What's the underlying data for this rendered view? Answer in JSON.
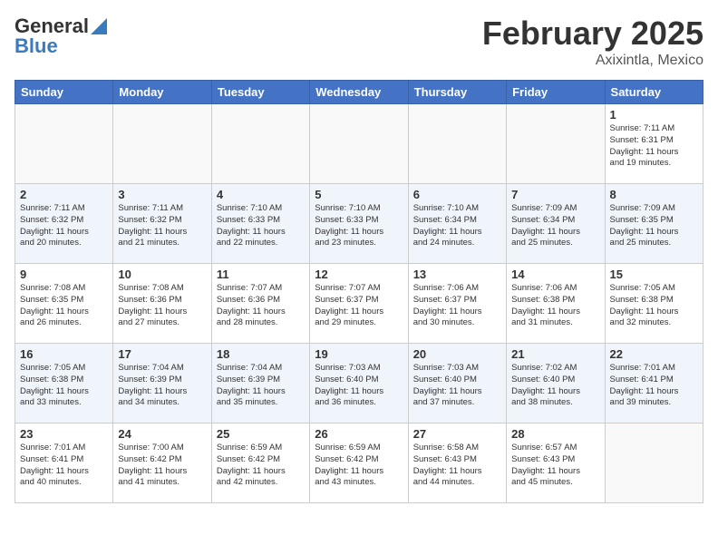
{
  "header": {
    "logo_general": "General",
    "logo_blue": "Blue",
    "month_title": "February 2025",
    "location": "Axixintla, Mexico"
  },
  "days_of_week": [
    "Sunday",
    "Monday",
    "Tuesday",
    "Wednesday",
    "Thursday",
    "Friday",
    "Saturday"
  ],
  "weeks": [
    {
      "days": [
        {
          "num": "",
          "info": ""
        },
        {
          "num": "",
          "info": ""
        },
        {
          "num": "",
          "info": ""
        },
        {
          "num": "",
          "info": ""
        },
        {
          "num": "",
          "info": ""
        },
        {
          "num": "",
          "info": ""
        },
        {
          "num": "1",
          "info": "Sunrise: 7:11 AM\nSunset: 6:31 PM\nDaylight: 11 hours\nand 19 minutes."
        }
      ]
    },
    {
      "days": [
        {
          "num": "2",
          "info": "Sunrise: 7:11 AM\nSunset: 6:32 PM\nDaylight: 11 hours\nand 20 minutes."
        },
        {
          "num": "3",
          "info": "Sunrise: 7:11 AM\nSunset: 6:32 PM\nDaylight: 11 hours\nand 21 minutes."
        },
        {
          "num": "4",
          "info": "Sunrise: 7:10 AM\nSunset: 6:33 PM\nDaylight: 11 hours\nand 22 minutes."
        },
        {
          "num": "5",
          "info": "Sunrise: 7:10 AM\nSunset: 6:33 PM\nDaylight: 11 hours\nand 23 minutes."
        },
        {
          "num": "6",
          "info": "Sunrise: 7:10 AM\nSunset: 6:34 PM\nDaylight: 11 hours\nand 24 minutes."
        },
        {
          "num": "7",
          "info": "Sunrise: 7:09 AM\nSunset: 6:34 PM\nDaylight: 11 hours\nand 25 minutes."
        },
        {
          "num": "8",
          "info": "Sunrise: 7:09 AM\nSunset: 6:35 PM\nDaylight: 11 hours\nand 25 minutes."
        }
      ]
    },
    {
      "days": [
        {
          "num": "9",
          "info": "Sunrise: 7:08 AM\nSunset: 6:35 PM\nDaylight: 11 hours\nand 26 minutes."
        },
        {
          "num": "10",
          "info": "Sunrise: 7:08 AM\nSunset: 6:36 PM\nDaylight: 11 hours\nand 27 minutes."
        },
        {
          "num": "11",
          "info": "Sunrise: 7:07 AM\nSunset: 6:36 PM\nDaylight: 11 hours\nand 28 minutes."
        },
        {
          "num": "12",
          "info": "Sunrise: 7:07 AM\nSunset: 6:37 PM\nDaylight: 11 hours\nand 29 minutes."
        },
        {
          "num": "13",
          "info": "Sunrise: 7:06 AM\nSunset: 6:37 PM\nDaylight: 11 hours\nand 30 minutes."
        },
        {
          "num": "14",
          "info": "Sunrise: 7:06 AM\nSunset: 6:38 PM\nDaylight: 11 hours\nand 31 minutes."
        },
        {
          "num": "15",
          "info": "Sunrise: 7:05 AM\nSunset: 6:38 PM\nDaylight: 11 hours\nand 32 minutes."
        }
      ]
    },
    {
      "days": [
        {
          "num": "16",
          "info": "Sunrise: 7:05 AM\nSunset: 6:38 PM\nDaylight: 11 hours\nand 33 minutes."
        },
        {
          "num": "17",
          "info": "Sunrise: 7:04 AM\nSunset: 6:39 PM\nDaylight: 11 hours\nand 34 minutes."
        },
        {
          "num": "18",
          "info": "Sunrise: 7:04 AM\nSunset: 6:39 PM\nDaylight: 11 hours\nand 35 minutes."
        },
        {
          "num": "19",
          "info": "Sunrise: 7:03 AM\nSunset: 6:40 PM\nDaylight: 11 hours\nand 36 minutes."
        },
        {
          "num": "20",
          "info": "Sunrise: 7:03 AM\nSunset: 6:40 PM\nDaylight: 11 hours\nand 37 minutes."
        },
        {
          "num": "21",
          "info": "Sunrise: 7:02 AM\nSunset: 6:40 PM\nDaylight: 11 hours\nand 38 minutes."
        },
        {
          "num": "22",
          "info": "Sunrise: 7:01 AM\nSunset: 6:41 PM\nDaylight: 11 hours\nand 39 minutes."
        }
      ]
    },
    {
      "days": [
        {
          "num": "23",
          "info": "Sunrise: 7:01 AM\nSunset: 6:41 PM\nDaylight: 11 hours\nand 40 minutes."
        },
        {
          "num": "24",
          "info": "Sunrise: 7:00 AM\nSunset: 6:42 PM\nDaylight: 11 hours\nand 41 minutes."
        },
        {
          "num": "25",
          "info": "Sunrise: 6:59 AM\nSunset: 6:42 PM\nDaylight: 11 hours\nand 42 minutes."
        },
        {
          "num": "26",
          "info": "Sunrise: 6:59 AM\nSunset: 6:42 PM\nDaylight: 11 hours\nand 43 minutes."
        },
        {
          "num": "27",
          "info": "Sunrise: 6:58 AM\nSunset: 6:43 PM\nDaylight: 11 hours\nand 44 minutes."
        },
        {
          "num": "28",
          "info": "Sunrise: 6:57 AM\nSunset: 6:43 PM\nDaylight: 11 hours\nand 45 minutes."
        },
        {
          "num": "",
          "info": ""
        }
      ]
    }
  ]
}
